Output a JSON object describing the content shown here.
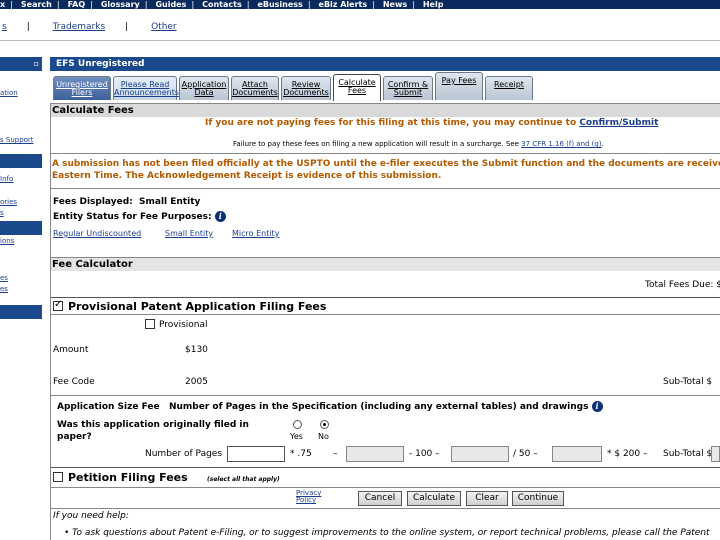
{
  "topnav": {
    "items": [
      "x",
      "Search",
      "FAQ",
      "Glossary",
      "Guides",
      "Contacts",
      "eBusiness",
      "eBiz Alerts",
      "News",
      "Help"
    ]
  },
  "secnav": {
    "items": [
      "s",
      "Trademarks",
      "Other"
    ]
  },
  "sidebar": {
    "head_glyph": "▫",
    "links": [
      "ation",
      "s Support",
      "Info",
      "ories",
      "s",
      "ions",
      "es",
      "es"
    ]
  },
  "app": {
    "title": "EFS Unregistered"
  },
  "tabs": [
    {
      "label": "Unregistered Filers"
    },
    {
      "label": "Please Read Announcements"
    },
    {
      "label": "Application Data"
    },
    {
      "label": "Attach Documents"
    },
    {
      "label": "Review Documents"
    },
    {
      "label": "Calculate Fees"
    },
    {
      "label": "Confirm & Submit"
    },
    {
      "label": "Pay Fees"
    },
    {
      "label": "Receipt"
    }
  ],
  "calculate_fees": {
    "title": "Calculate Fees",
    "notice_text": "If you are not paying fees for this filing at this time, you may continue to",
    "notice_link": "Confirm/Submit",
    "surcharge_text": "Failure to pay these fees on filing a new application will result in a surcharge. See",
    "surcharge_link": "37 CFR 1.16 (f) and (g)",
    "surcharge_end": ".",
    "warning_line1": "A submission has not been filed officially at the USPTO until the e-filer executes the Submit function and the documents are received",
    "warning_line2": "Eastern Time. The Acknowledgement Receipt is evidence of this submission.",
    "fees_displayed_label": "Fees Displayed:",
    "fees_displayed_value": "Small Entity",
    "entity_status_label": "Entity Status for Fee Purposes:",
    "entity_links": [
      "Regular Undiscounted",
      "Small Entity",
      "Micro Entity"
    ]
  },
  "fee_calculator": {
    "title": "Fee Calculator",
    "total_fees_label": "Total Fees Due: $"
  },
  "provisional": {
    "title": "Provisional Patent Application Filing Fees",
    "checked": true,
    "option_label": "Provisional",
    "amount_label": "Amount",
    "amount_value": "$130",
    "fee_code_label": "Fee Code",
    "fee_code_value": "2005",
    "subtotal_label": "Sub-Total $",
    "size_fee_label": "Application Size Fee",
    "size_fee_desc": "Number of Pages in the Specification (including any external tables) and drawings",
    "paper_question_line1": "Was this application originally filed in",
    "paper_question_line2": "paper?",
    "yes_label": "Yes",
    "no_label": "No",
    "selected": "No",
    "pages_label": "Number of Pages",
    "mult": "* .75",
    "minus1": "–",
    "minus100": "- 100 –",
    "div50": "/ 50 –",
    "times200": "* $ 200 –",
    "subtotal2_label": "Sub-Total $"
  },
  "petition": {
    "title": "Petition Filing Fees",
    "checked": false,
    "note": "(select all that apply)"
  },
  "buttons": {
    "privacy": "Privacy Policy",
    "cancel": "Cancel",
    "calculate": "Calculate",
    "clear": "Clear",
    "continue": "Continue"
  },
  "help": {
    "title": "If you need help:",
    "bullet": "To ask questions about Patent e-Filing, or to suggest improvements to the online system, or report technical problems, please call the Patent"
  },
  "colors": {
    "nav_dark": "#0a2a5e",
    "header_blue": "#1a4a8c",
    "link_blue": "#1a3f8c",
    "warning_orange": "#b35a00",
    "section_gray": "#d9d9d9"
  }
}
